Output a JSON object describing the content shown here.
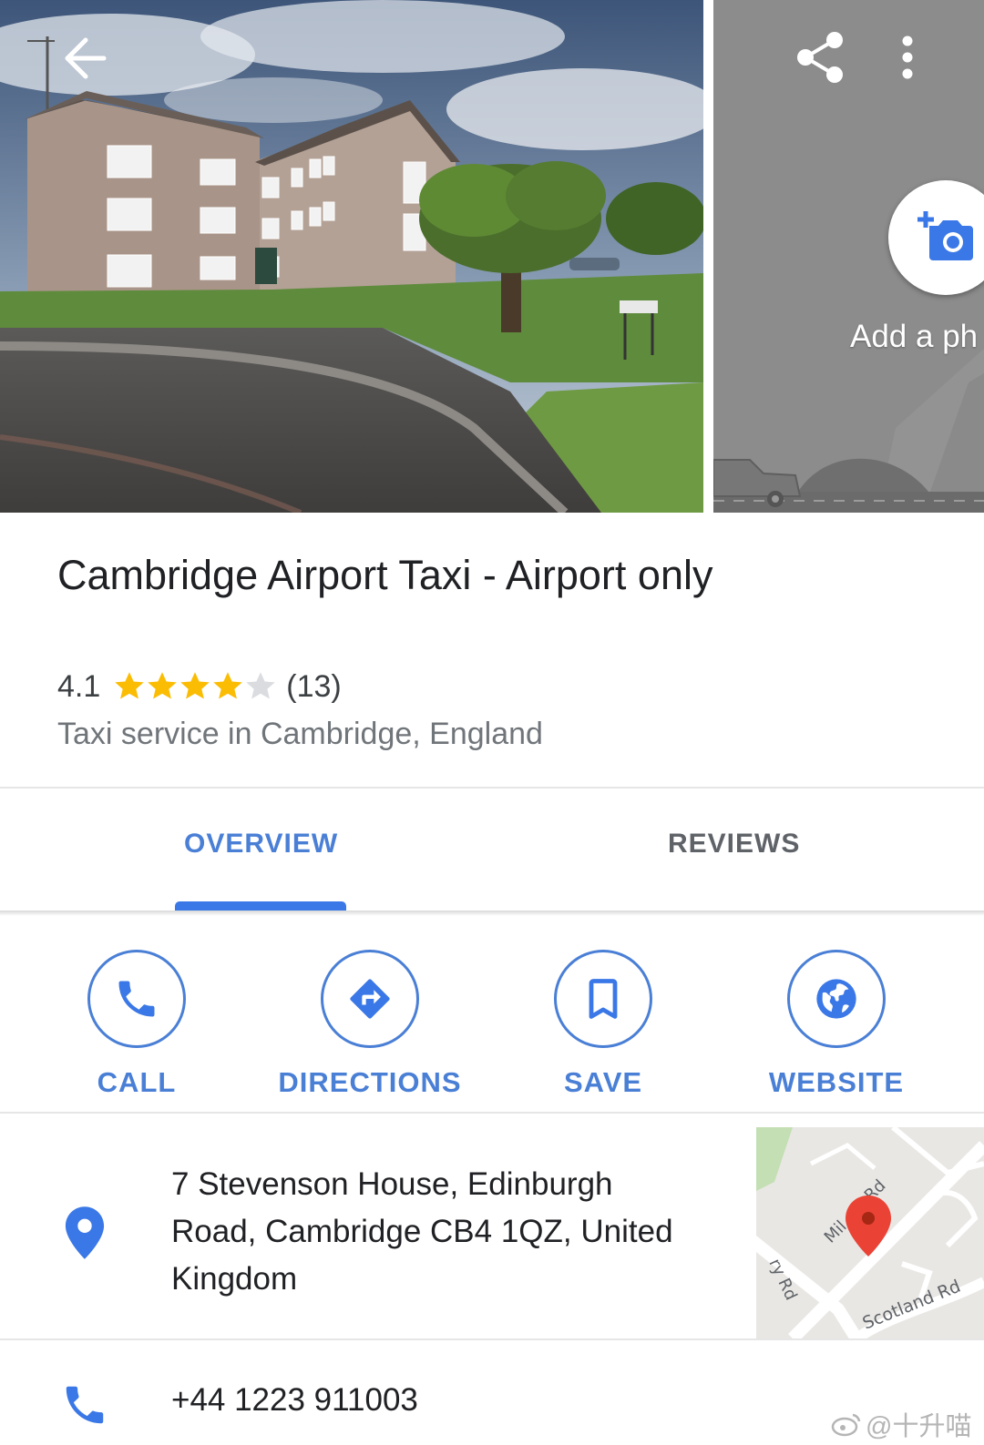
{
  "header": {
    "add_photo_label": "Add a ph"
  },
  "place": {
    "title": "Cambridge Airport Taxi - Airport only",
    "rating": "4.1",
    "rating_value": 4.1,
    "max_stars": 5,
    "review_count": "(13)",
    "category": "Taxi service in Cambridge, England"
  },
  "tabs": [
    {
      "label": "OVERVIEW",
      "active": true
    },
    {
      "label": "REVIEWS",
      "active": false
    }
  ],
  "actions": [
    {
      "label": "CALL",
      "icon": "phone-icon"
    },
    {
      "label": "DIRECTIONS",
      "icon": "directions-icon"
    },
    {
      "label": "SAVE",
      "icon": "bookmark-icon"
    },
    {
      "label": "WEBSITE",
      "icon": "globe-icon"
    }
  ],
  "address": {
    "line1": "7 Stevenson House, Edinburgh",
    "line2": "Road, Cambridge CB4 1QZ, United",
    "line3": "Kingdom",
    "icon": "location-pin-icon"
  },
  "map": {
    "road_labels": [
      "ry Rd",
      "Mil",
      "Rd",
      "Scotland Rd"
    ]
  },
  "phone": {
    "number": "+44 1223 911003",
    "icon": "phone-icon"
  },
  "watermark": {
    "text": "@十升喵"
  },
  "colors": {
    "accent": "#4a7fd6",
    "star": "#fbbc04",
    "star_empty": "#dadce0",
    "pin": "#ea4335"
  }
}
